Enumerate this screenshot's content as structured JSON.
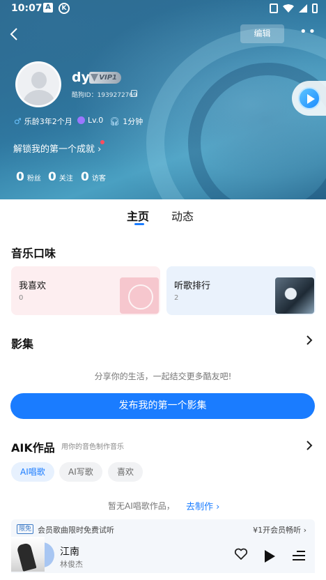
{
  "statusbar": {
    "time": "10:07",
    "icon_a": "A",
    "icon_k": "K"
  },
  "header": {
    "edit_label": "编辑",
    "more_label": "••"
  },
  "profile": {
    "username": "dy",
    "vip_label": "VIP1",
    "user_id": "酷狗ID：1939272769",
    "music_age": "乐龄3年2个月",
    "level": "Lv.0",
    "listen_time": "1分钟",
    "achievement": "解锁我的第一个成就",
    "stats": [
      {
        "num": "0",
        "label": "粉丝"
      },
      {
        "num": "0",
        "label": "关注"
      },
      {
        "num": "0",
        "label": "访客"
      }
    ]
  },
  "tabs": [
    {
      "label": "主页"
    },
    {
      "label": "动态"
    }
  ],
  "music_taste": {
    "title": "音乐口味",
    "cards": [
      {
        "title": "我喜欢",
        "count": "0"
      },
      {
        "title": "听歌排行",
        "count": "2"
      }
    ]
  },
  "album": {
    "title": "影集",
    "empty_text": "分享你的生活，一起结交更多酷友吧!",
    "button_label": "发布我的第一个影集"
  },
  "aik": {
    "title": "AIK作品",
    "subtitle": "用你的音色制作音乐",
    "chips": [
      {
        "label": "AI唱歌"
      },
      {
        "label": "AI写歌"
      },
      {
        "label": "喜欢"
      }
    ],
    "empty_text": "暂无AI唱歌作品，",
    "make_link": "去制作 ›"
  },
  "vip_banner": {
    "badge": "限免",
    "text": "会员歌曲限时免费试听",
    "cta": "¥1开会员畅听 ›"
  },
  "player": {
    "song": "江南",
    "artist": "林俊杰"
  },
  "colors": {
    "accent": "#1a7cff",
    "hero": "#2f7aa3"
  }
}
